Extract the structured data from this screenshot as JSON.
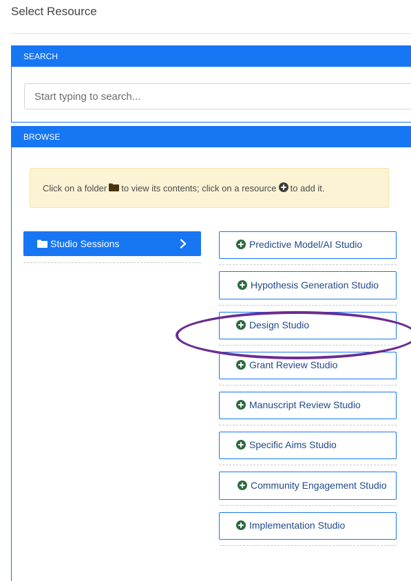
{
  "page": {
    "title": "Select Resource"
  },
  "search": {
    "header": "SEARCH",
    "placeholder": "Start typing to search...",
    "value": ""
  },
  "browse": {
    "header": "BROWSE",
    "hint_part1": "Click on a folder",
    "hint_part2": "to view its contents; click on a resource",
    "hint_part3": "to add it.",
    "folder": {
      "label": "Studio Sessions",
      "icon": "folder-icon",
      "chevron": "chevron-right-icon"
    },
    "resources": [
      {
        "label": "Predictive Model/AI Studio"
      },
      {
        "label": "Hypothesis Generation Studio"
      },
      {
        "label": "Design Studio"
      },
      {
        "label": "Grant Review Studio"
      },
      {
        "label": "Manuscript Review Studio"
      },
      {
        "label": "Specific Aims Studio"
      },
      {
        "label": "Community Engagement Studio"
      },
      {
        "label": "Implementation Studio"
      }
    ]
  },
  "colors": {
    "primary": "#1676f3",
    "hint_background": "#fcf3d4",
    "add_icon": "#2d6a3e",
    "annotation": "#6a2d91"
  }
}
